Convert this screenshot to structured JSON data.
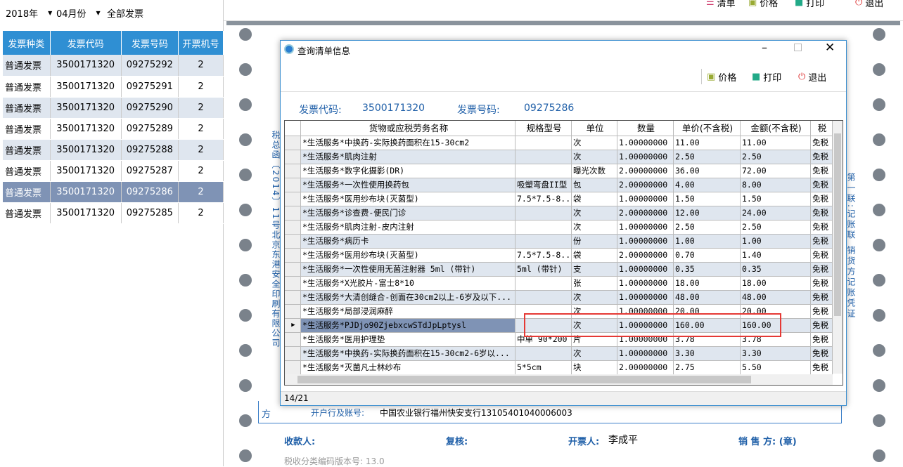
{
  "filters": {
    "year": "2018年",
    "month": "04月份",
    "type": "全部发票"
  },
  "left_table": {
    "headers": [
      "发票种类",
      "发票代码",
      "发票号码",
      "开票机号"
    ],
    "rows": [
      [
        "普通发票",
        "3500171320",
        "09275292",
        "2"
      ],
      [
        "普通发票",
        "3500171320",
        "09275291",
        "2"
      ],
      [
        "普通发票",
        "3500171320",
        "09275290",
        "2"
      ],
      [
        "普通发票",
        "3500171320",
        "09275289",
        "2"
      ],
      [
        "普通发票",
        "3500171320",
        "09275288",
        "2"
      ],
      [
        "普通发票",
        "3500171320",
        "09275287",
        "2"
      ],
      [
        "普通发票",
        "3500171320",
        "09275286",
        "2"
      ],
      [
        "普通发票",
        "3500171320",
        "09275285",
        "2"
      ]
    ],
    "selected_index": 6
  },
  "top_toolbar": {
    "list": "清单",
    "price": "价格",
    "print": "打印",
    "exit": "退出"
  },
  "invoice": {
    "bank_label": "开户行及账号:",
    "bank_value": "中国农业银行福州快安支行13105401040006003",
    "side_label": "方",
    "payee": "收款人:",
    "reviewer": "复核:",
    "drawer_label": "开票人:",
    "drawer": "李成平",
    "seller": "销 售 方: (章)",
    "version": "税收分类编码版本号: 13.0",
    "left_vertical": "税总函〔2014〕11号北京东港安全印刷有限公司",
    "right_vertical": "第一联:记账联 销货方记账凭证"
  },
  "dialog": {
    "title": "查询清单信息",
    "price_btn": "价格",
    "print_btn": "打印",
    "exit_btn": "退出",
    "code_label": "发票代码:",
    "code": "3500171320",
    "number_label": "发票号码:",
    "number": "09275286",
    "status": "14/21",
    "columns": [
      "货物或应税劳务名称",
      "规格型号",
      "单位",
      "数量",
      "单价(不含税)",
      "金额(不含税)",
      "税"
    ],
    "rows": [
      [
        "*生活服务*中换药-实际换药面积在15-30cm2",
        "",
        "次",
        "1.00000000",
        "11.00",
        "11.00",
        "免税"
      ],
      [
        "*生活服务*肌肉注射",
        "",
        "次",
        "1.00000000",
        "2.50",
        "2.50",
        "免税"
      ],
      [
        "*生活服务*数字化摄影(DR)",
        "",
        "曝光次数",
        "2.00000000",
        "36.00",
        "72.00",
        "免税"
      ],
      [
        "*生活服务*一次性使用换药包",
        "吸塑弯盘II型",
        "包",
        "2.00000000",
        "4.00",
        "8.00",
        "免税"
      ],
      [
        "*生活服务*医用纱布块(灭菌型)",
        "7.5*7.5-8...",
        "袋",
        "1.00000000",
        "1.50",
        "1.50",
        "免税"
      ],
      [
        "*生活服务*诊查费-便民门诊",
        "",
        "次",
        "2.00000000",
        "12.00",
        "24.00",
        "免税"
      ],
      [
        "*生活服务*肌肉注射-皮内注射",
        "",
        "次",
        "1.00000000",
        "2.50",
        "2.50",
        "免税"
      ],
      [
        "*生活服务*病历卡",
        "",
        "份",
        "1.00000000",
        "1.00",
        "1.00",
        "免税"
      ],
      [
        "*生活服务*医用纱布块(灭菌型)",
        "7.5*7.5-8...",
        "袋",
        "2.00000000",
        "0.70",
        "1.40",
        "免税"
      ],
      [
        "*生活服务*一次性使用无菌注射器 5ml (带针)",
        "5ml (带针)",
        "支",
        "1.00000000",
        "0.35",
        "0.35",
        "免税"
      ],
      [
        "*生活服务*X光胶片-富士8*10",
        "",
        "张",
        "1.00000000",
        "18.00",
        "18.00",
        "免税"
      ],
      [
        "*生活服务*大清创缝合-创面在30cm2以上-6岁及以下...",
        "",
        "次",
        "1.00000000",
        "48.00",
        "48.00",
        "免税"
      ],
      [
        "*生活服务*局部浸润麻醉",
        "",
        "次",
        "1.00000000",
        "20.00",
        "20.00",
        "免税"
      ],
      [
        "*生活服务*PJDjo90ZjebxcwSTdJpLptysl",
        "",
        "次",
        "1.00000000",
        "160.00",
        "160.00",
        "免税"
      ],
      [
        "*生活服务*医用护理垫",
        "中单 90*200",
        "片",
        "1.00000000",
        "3.78",
        "3.78",
        "免税"
      ],
      [
        "*生活服务*中换药-实际换药面积在15-30cm2-6岁以...",
        "",
        "次",
        "1.00000000",
        "3.30",
        "3.30",
        "免税"
      ],
      [
        "*生活服务*灭菌凡士林纱布",
        "5*5cm",
        "块",
        "2.00000000",
        "2.75",
        "5.50",
        "免税"
      ]
    ],
    "selected_index": 13
  },
  "colors": {
    "header_blue": "#2f8fd3",
    "selected": "#7f93b5",
    "highlight_box": "#e53935"
  }
}
